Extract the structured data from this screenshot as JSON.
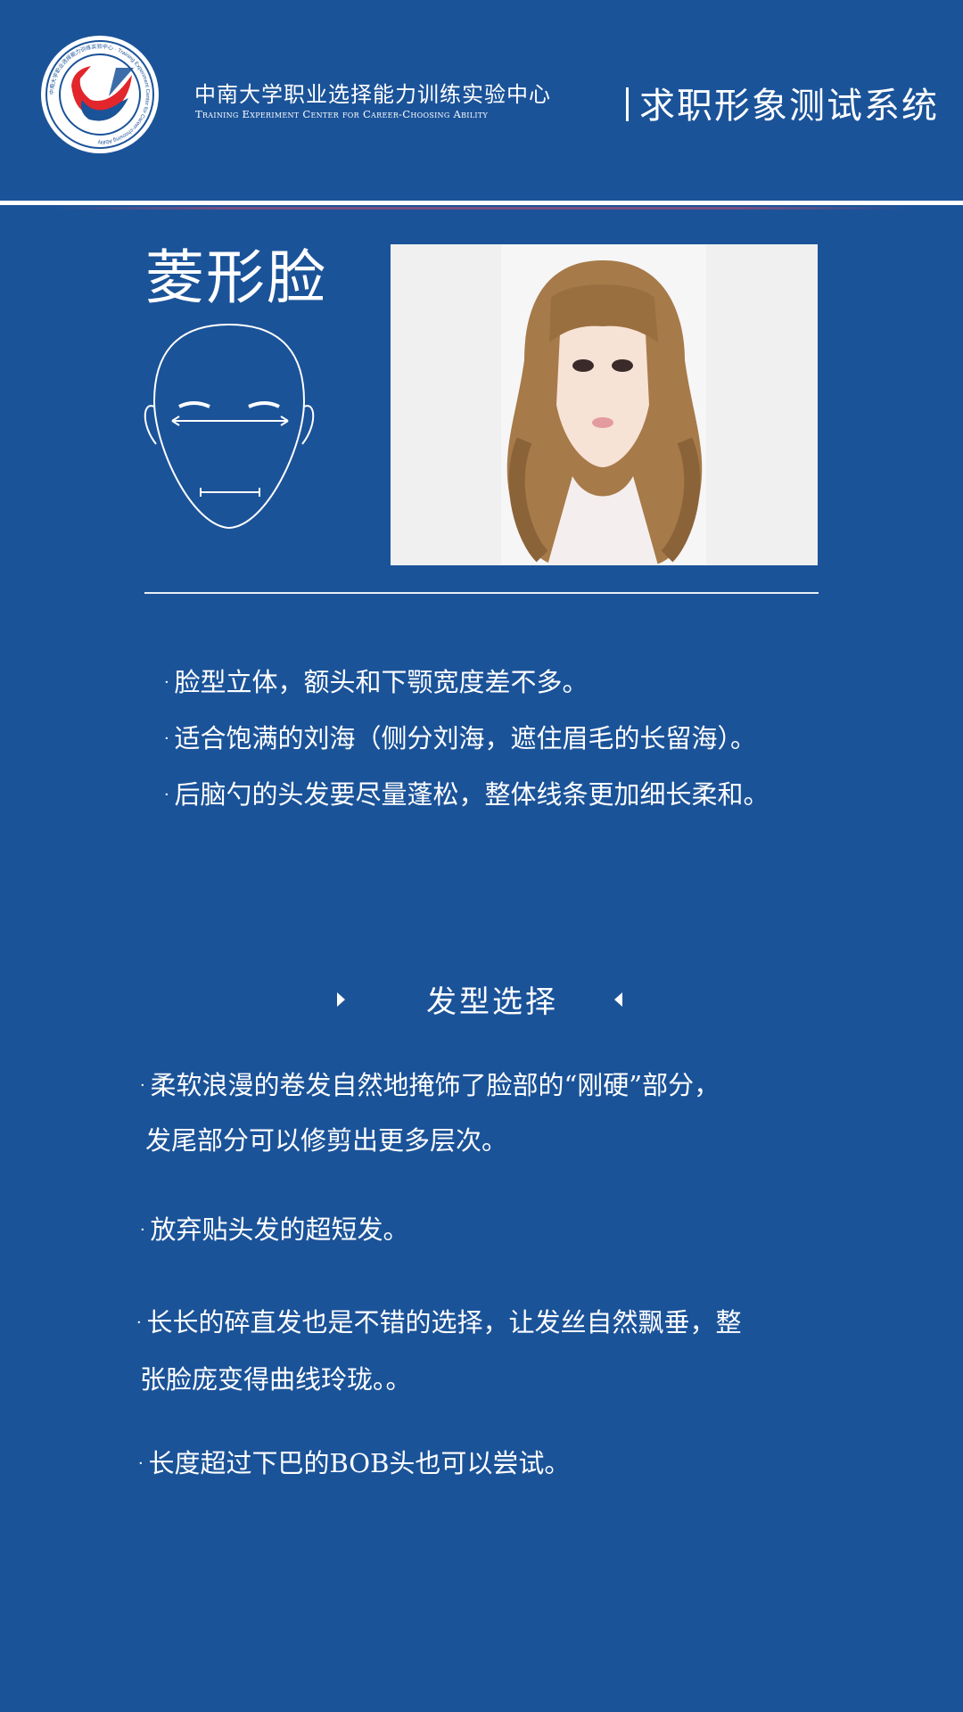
{
  "header": {
    "org_name_cn": "中南大学职业选择能力训练实验中心",
    "org_name_en": "Training Experiment Center for Career-Choosing Ability",
    "system_title": "求职形象测试系统",
    "logo_ring_text": "中南大学职业选择能力训练实验中心 · Training Experiment Center for Career-choosing Ability"
  },
  "face": {
    "title": "菱形脸",
    "diagram_icon": "face-outline-icon",
    "photo_icon": "woman-wavy-hair-photo"
  },
  "features": [
    "脸型立体，额头和下颚宽度差不多。",
    "适合饱满的刘海（侧分刘海，遮住眉毛的长留海）。",
    "后脑勺的头发要尽量蓬松，整体线条更加细长柔和。"
  ],
  "hairstyle": {
    "heading": "发型选择",
    "items": [
      {
        "line1": "柔软浪漫的卷发自然地掩饰了脸部的“刚硬”部分，",
        "line2": "发尾部分可以修剪出更多层次。"
      },
      {
        "line1": "放弃贴头发的超短发。",
        "line2": ""
      },
      {
        "line1": "长长的碎直发也是不错的选择，让发丝自然飘垂，整",
        "line2": "张脸庞变得曲线玲珑。。"
      },
      {
        "line1": "长度超过下巴的BOB头也可以尝试。",
        "line2": ""
      }
    ]
  },
  "colors": {
    "background": "#1b5399",
    "text": "#ffffff",
    "logo_red": "#e2262b",
    "logo_blue": "#1b5399"
  }
}
